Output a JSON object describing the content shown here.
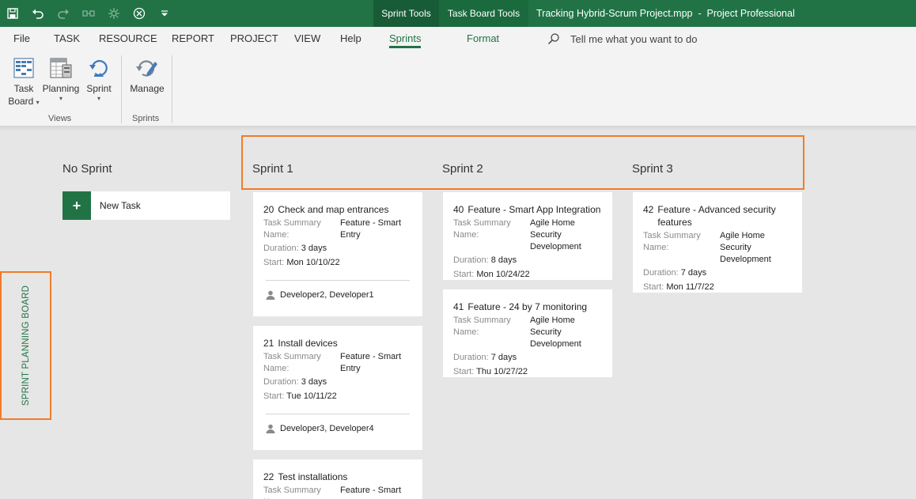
{
  "titlebar": {
    "context_tabs": [
      "Sprint Tools",
      "Task Board Tools"
    ],
    "document_title": "Tracking Hybrid-Scrum Project.mpp  -  Project Professional",
    "qat_icons": [
      "save-icon",
      "undo-icon",
      "redo-icon",
      "link-icon",
      "settings-icon",
      "autofilter-icon",
      "customize-qat-icon"
    ]
  },
  "menu": {
    "items": [
      "File",
      "TASK",
      "RESOURCE",
      "REPORT",
      "PROJECT",
      "VIEW",
      "Help",
      "Sprints",
      "Format"
    ],
    "active": "Sprints",
    "tellme": "Tell me what you want to do"
  },
  "ribbon": {
    "task_board": "Task\nBoard",
    "planning": "Planning",
    "sprint": "Sprint",
    "manage": "Manage",
    "group_views": "Views",
    "group_sprints": "Sprints"
  },
  "board": {
    "vertical_label": "SPRINT PLANNING BOARD",
    "new_task": "New Task",
    "columns": [
      "No Sprint",
      "Sprint 1",
      "Sprint 2",
      "Sprint 3"
    ],
    "field_labels": {
      "summary": "Task Summary Name:",
      "duration": "Duration:",
      "start": "Start:"
    },
    "cards": [
      {
        "num": "20",
        "title": "Check and map entrances",
        "summary": "Feature - Smart Entry",
        "duration": "3 days",
        "start": "Mon 10/10/22",
        "assignees": "Developer2, Developer1"
      },
      {
        "num": "21",
        "title": "Install devices",
        "summary": "Feature - Smart Entry",
        "duration": "3 days",
        "start": "Tue 10/11/22",
        "assignees": "Developer3, Developer4"
      },
      {
        "num": "22",
        "title": "Test installations",
        "summary": "Feature - Smart"
      },
      {
        "num": "40",
        "title": "Feature - Smart App Integration",
        "summary": "Agile Home Security Development",
        "duration": "8 days",
        "start": "Mon 10/24/22"
      },
      {
        "num": "41",
        "title": "Feature - 24 by 7 monitoring",
        "summary": "Agile Home Security Development",
        "duration": "7 days",
        "start": "Thu 10/27/22"
      },
      {
        "num": "42",
        "title": "Feature - Advanced security features",
        "summary": "Agile Home Security Development",
        "duration": "7 days",
        "start": "Mon 11/7/22"
      }
    ]
  },
  "colors": {
    "brand_green": "#217346",
    "highlight_orange": "#f07c2a",
    "board_bg": "#e6e6e6"
  }
}
